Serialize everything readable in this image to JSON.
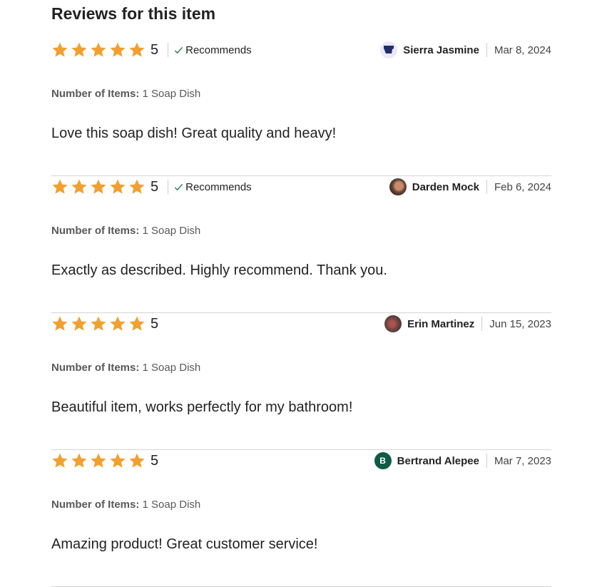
{
  "heading": "Reviews for this item",
  "colors": {
    "star": "#f1a02f",
    "check": "#2b7a3f",
    "divider": "#d5d5d5"
  },
  "reviews": [
    {
      "rating": "5",
      "stars": 5,
      "recommends": "Recommends",
      "author": "Sierra Jasmine",
      "avatar_icon": "state-shape-avatar",
      "date": "Mar 8, 2024",
      "variation_label": "Number of Items:",
      "variation_value": "1 Soap Dish",
      "text": "Love this soap dish! Great quality and heavy!"
    },
    {
      "rating": "5",
      "stars": 5,
      "recommends": "Recommends",
      "author": "Darden Mock",
      "avatar_icon": "photo-avatar",
      "date": "Feb 6, 2024",
      "variation_label": "Number of Items:",
      "variation_value": "1 Soap Dish",
      "text": "Exactly as described. Highly recommend. Thank you."
    },
    {
      "rating": "5",
      "stars": 5,
      "recommends": "",
      "author": "Erin Martinez",
      "avatar_icon": "photo-avatar",
      "date": "Jun 15, 2023",
      "variation_label": "Number of Items:",
      "variation_value": "1 Soap Dish",
      "text": "Beautiful item, works perfectly for my bathroom!"
    },
    {
      "rating": "5",
      "stars": 5,
      "recommends": "",
      "author": "Bertrand Alepee",
      "avatar_icon": "initial-avatar",
      "avatar_initial": "B",
      "date": "Mar 7, 2023",
      "variation_label": "Number of Items:",
      "variation_value": "1 Soap Dish",
      "text": "Amazing product! Great customer service!"
    }
  ]
}
